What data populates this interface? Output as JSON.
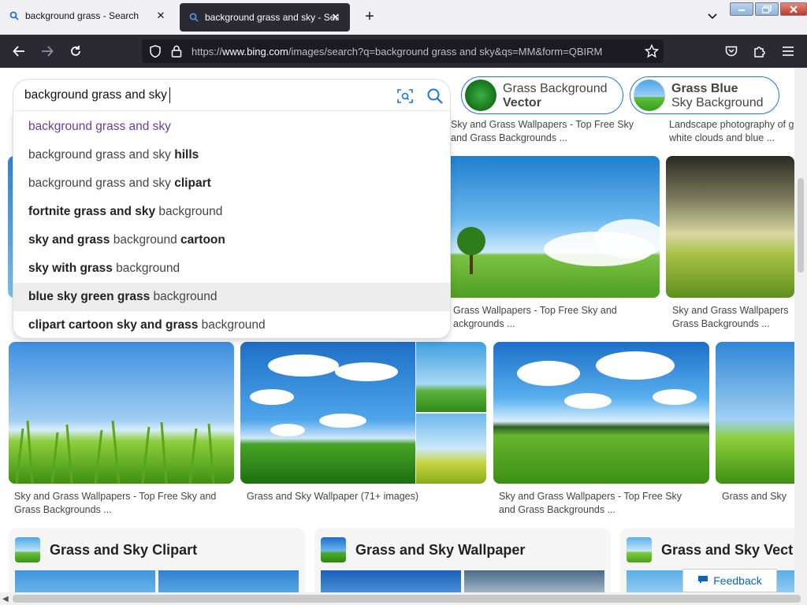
{
  "browser": {
    "tabs": [
      {
        "title": "background grass - Search",
        "active": false
      },
      {
        "title": "background grass and sky - Sear",
        "active": true
      }
    ],
    "url": {
      "scheme": "https://",
      "host": "www.bing.com",
      "path": "/images/search?q=background grass and sky&qs=MM&form=QBIRM"
    }
  },
  "search": {
    "query": "background grass and sky",
    "suggestions": [
      {
        "plain_before": "background grass and sky",
        "bold": "",
        "plain_after": ""
      },
      {
        "plain_before": "background grass and sky ",
        "bold": "hills",
        "plain_after": ""
      },
      {
        "plain_before": "background grass and sky ",
        "bold": "clipart",
        "plain_after": ""
      },
      {
        "plain_before": "",
        "bold": "fortnite grass and sky",
        "plain_after": " background"
      },
      {
        "plain_before": "",
        "bold": "sky and grass",
        "plain_after": " background ",
        "bold2": "cartoon"
      },
      {
        "plain_before": "",
        "bold": "sky with grass",
        "plain_after": " background"
      },
      {
        "plain_before": "",
        "bold": "blue sky green grass",
        "plain_after": " background"
      },
      {
        "plain_before": "",
        "bold": "clipart cartoon sky and grass",
        "plain_after": " background"
      }
    ]
  },
  "related_chips": [
    {
      "line1": "Grass Background",
      "line2": "Vector"
    },
    {
      "line1": "Grass Blue",
      "line2": "Sky Background"
    }
  ],
  "results": {
    "row1_captions": [
      {
        "l1": "Sky and Grass Wallpapers - Top Free Sky",
        "l2": "and Grass Backgrounds ..."
      },
      {
        "l1": "Landscape photography of g",
        "l2": "white clouds and blue ..."
      }
    ],
    "row2_captions": [
      {
        "l1": "Grass Wallpapers - Top Free Sky and",
        "l2": "ackgrounds ..."
      },
      {
        "l1": "Sky and Grass Wallpapers",
        "l2": "Grass Backgrounds ..."
      }
    ],
    "row3_captions": [
      {
        "l1": "Sky and Grass Wallpapers - Top Free Sky and",
        "l2": "Grass Backgrounds ..."
      },
      {
        "l1": "Grass and Sky Wallpaper (71+ images)",
        "l2": ""
      },
      {
        "l1": "Sky and Grass Wallpapers - Top Free Sky",
        "l2": "and Grass Backgrounds ..."
      },
      {
        "l1": "Grass and Sky",
        "l2": ""
      }
    ]
  },
  "categories": [
    {
      "title": "Grass and Sky Clipart"
    },
    {
      "title": "Grass and Sky Wallpaper"
    },
    {
      "title": "Grass and Sky Vect"
    }
  ],
  "feedback_label": "Feedback"
}
